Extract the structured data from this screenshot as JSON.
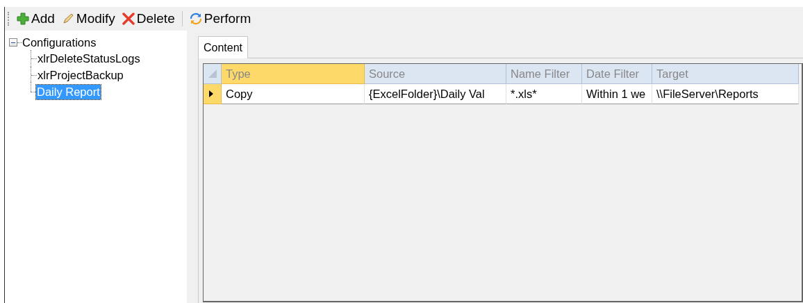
{
  "toolbar": [
    {
      "label": "Add",
      "kind": "add"
    },
    {
      "label": "Modify",
      "kind": "modify"
    },
    {
      "label": "Delete",
      "kind": "delete"
    },
    {
      "label": "Perform",
      "kind": "perform"
    }
  ],
  "tree": {
    "label": "Configurations",
    "expanded": true,
    "children": [
      {
        "label": "xlrDeleteStatusLogs",
        "selected": false
      },
      {
        "label": "xlrProjectBackup",
        "selected": false
      },
      {
        "label": "Daily Report",
        "selected": true
      }
    ]
  },
  "tabs": [
    {
      "label": "Content",
      "selected": true
    }
  ],
  "table": {
    "columns": [
      {
        "label": "Type",
        "selected": true
      },
      {
        "label": "Source",
        "selected": false
      },
      {
        "label": "Name Filter",
        "selected": false
      },
      {
        "label": "Date Filter",
        "selected": false
      },
      {
        "label": "Target",
        "selected": false
      }
    ],
    "rows": [
      {
        "current": true,
        "cells": [
          "Copy",
          "{ExcelFolder}\\Daily Val",
          "*.xls*",
          "Within 1 we",
          "\\\\FileServer\\Reports"
        ]
      }
    ]
  }
}
